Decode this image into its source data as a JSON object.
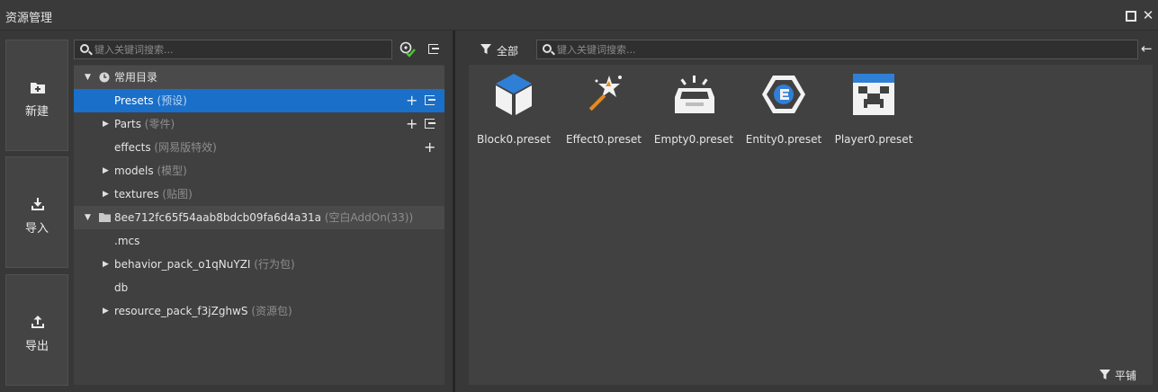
{
  "window": {
    "title": "资源管理"
  },
  "actions": [
    {
      "label": "新建",
      "icon": "new-folder-icon"
    },
    {
      "label": "导入",
      "icon": "import-icon"
    },
    {
      "label": "导出",
      "icon": "export-icon"
    }
  ],
  "left_search": {
    "placeholder": "键入关键词搜索..."
  },
  "tree": {
    "common_group": {
      "label": "常用目录"
    },
    "common_items": [
      {
        "name": "Presets",
        "note": "(预设)"
      },
      {
        "name": "Parts",
        "note": "(零件)"
      },
      {
        "name": "effects",
        "note": "(网易版特效)"
      },
      {
        "name": "models",
        "note": "(模型)"
      },
      {
        "name": "textures",
        "note": "(贴图)"
      }
    ],
    "project_group": {
      "label": "8ee712fc65f54aab8bdcb09fa6d4a31a",
      "note": "(空白AddOn(33))"
    },
    "project_items": [
      {
        "name": ".mcs",
        "note": ""
      },
      {
        "name": "behavior_pack_o1qNuYZI",
        "note": "(行为包)"
      },
      {
        "name": "db",
        "note": ""
      },
      {
        "name": "resource_pack_f3jZghwS",
        "note": "(资源包)"
      }
    ]
  },
  "right": {
    "filter_label": "全部",
    "search_placeholder": "键入关键词搜索...",
    "flat_label": "平铺"
  },
  "assets": [
    {
      "label": "Block0.preset",
      "icon": "block-cube-icon"
    },
    {
      "label": "Effect0.preset",
      "icon": "magic-wand-icon"
    },
    {
      "label": "Empty0.preset",
      "icon": "empty-tray-icon"
    },
    {
      "label": "Entity0.preset",
      "icon": "entity-hexagon-icon"
    },
    {
      "label": "Player0.preset",
      "icon": "player-face-icon"
    }
  ],
  "colors": {
    "selection": "#1a6fc9",
    "accent_green": "#4cc832",
    "block_blue": "#2f7fd6",
    "wand_orange": "#e88a1a"
  }
}
